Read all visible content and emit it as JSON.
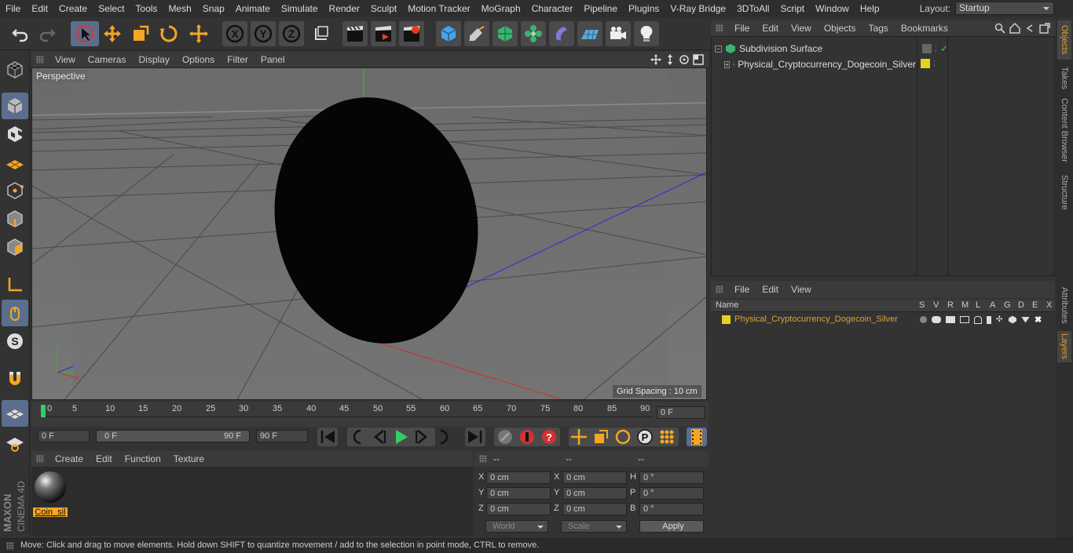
{
  "menubar": {
    "items": [
      "File",
      "Edit",
      "Create",
      "Select",
      "Tools",
      "Mesh",
      "Snap",
      "Animate",
      "Simulate",
      "Render",
      "Sculpt",
      "Motion Tracker",
      "MoGraph",
      "Character",
      "Pipeline",
      "Plugins",
      "V-Ray Bridge",
      "3DToAll",
      "Script",
      "Window",
      "Help"
    ],
    "layout_label": "Layout:",
    "layout_value": "Startup"
  },
  "viewport": {
    "menu": [
      "View",
      "Cameras",
      "Display",
      "Options",
      "Filter",
      "Panel"
    ],
    "camera_label": "Perspective",
    "grid_spacing": "Grid Spacing : 10 cm"
  },
  "timeline": {
    "ticks": [
      "0",
      "5",
      "10",
      "15",
      "20",
      "25",
      "30",
      "35",
      "40",
      "45",
      "50",
      "55",
      "60",
      "65",
      "70",
      "75",
      "80",
      "85",
      "90"
    ],
    "current_frame": "0 F"
  },
  "anim": {
    "start": "0 F",
    "range_start": "0 F",
    "range_end": "90 F",
    "end": "90 F"
  },
  "material": {
    "menu": [
      "Create",
      "Edit",
      "Function",
      "Texture"
    ],
    "name": "Coin_sil"
  },
  "coords": {
    "headers": [
      "--",
      "--",
      "--"
    ],
    "rows": [
      {
        "l1": "X",
        "v1": "0 cm",
        "l2": "X",
        "v2": "0 cm",
        "l3": "H",
        "v3": "0 °"
      },
      {
        "l1": "Y",
        "v1": "0 cm",
        "l2": "Y",
        "v2": "0 cm",
        "l3": "P",
        "v3": "0 °"
      },
      {
        "l1": "Z",
        "v1": "0 cm",
        "l2": "Z",
        "v2": "0 cm",
        "l3": "B",
        "v3": "0 °"
      }
    ],
    "mode": "World",
    "scale": "Scale",
    "apply": "Apply"
  },
  "objects": {
    "menu": [
      "File",
      "Edit",
      "View",
      "Objects",
      "Tags",
      "Bookmarks"
    ],
    "items": [
      "Subdivision Surface",
      "Physical_Cryptocurrency_Dogecoin_Silver"
    ]
  },
  "layers": {
    "menu": [
      "File",
      "Edit",
      "View"
    ],
    "header_name": "Name",
    "columns": [
      "S",
      "V",
      "R",
      "M",
      "L",
      "A",
      "G",
      "D",
      "E",
      "X"
    ],
    "items": [
      "Physical_Cryptocurrency_Dogecoin_Silver"
    ]
  },
  "right_tabs": [
    "Objects",
    "Takes",
    "Content Browser",
    "Structure",
    "Attributes",
    "Layers"
  ],
  "status": "Move: Click and drag to move elements. Hold down SHIFT to quantize movement / add to the selection in point mode, CTRL to remove.",
  "colors": {
    "accent": "#e0a030",
    "active_tool": "#5b6e8e",
    "layer_color": "#e6d21c"
  }
}
